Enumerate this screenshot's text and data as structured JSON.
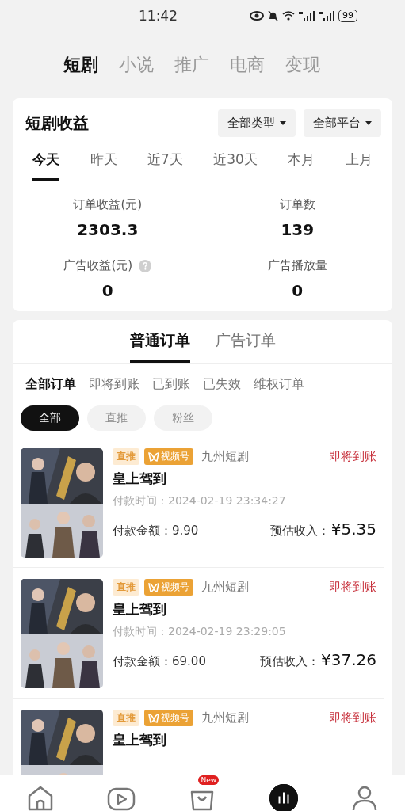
{
  "status_bar": {
    "time": "11:42",
    "battery": "99"
  },
  "top_tabs": [
    {
      "label": "短剧",
      "selected": true
    },
    {
      "label": "小说",
      "selected": false
    },
    {
      "label": "推广",
      "selected": false
    },
    {
      "label": "电商",
      "selected": false
    },
    {
      "label": "变现",
      "selected": false
    }
  ],
  "earnings": {
    "title": "短剧收益",
    "filters": [
      "全部类型",
      "全部平台"
    ],
    "periods": [
      {
        "label": "今天",
        "selected": true
      },
      {
        "label": "昨天",
        "selected": false
      },
      {
        "label": "近7天",
        "selected": false
      },
      {
        "label": "近30天",
        "selected": false
      },
      {
        "label": "本月",
        "selected": false
      },
      {
        "label": "上月",
        "selected": false
      }
    ],
    "stats": [
      {
        "label": "订单收益(元)",
        "value": "2303.3",
        "help": false
      },
      {
        "label": "订单数",
        "value": "139",
        "help": false
      },
      {
        "label": "广告收益(元)",
        "value": "0",
        "help": true
      },
      {
        "label": "广告播放量",
        "value": "0",
        "help": false
      }
    ]
  },
  "orders": {
    "tabs": [
      {
        "label": "普通订单",
        "selected": true
      },
      {
        "label": "广告订单",
        "selected": false
      }
    ],
    "status_tabs": [
      {
        "label": "全部订单",
        "selected": true
      },
      {
        "label": "即将到账",
        "selected": false
      },
      {
        "label": "已到账",
        "selected": false
      },
      {
        "label": "已失效",
        "selected": false
      },
      {
        "label": "维权订单",
        "selected": false
      }
    ],
    "chips": [
      {
        "label": "全部",
        "selected": true
      },
      {
        "label": "直推",
        "selected": false
      },
      {
        "label": "粉丝",
        "selected": false
      }
    ],
    "items": [
      {
        "tags": [
          {
            "kind": "direct",
            "label": "直推"
          },
          {
            "kind": "channel",
            "label": "视频号"
          }
        ],
        "platform": "九州短剧",
        "status": "即将到账",
        "title": "皇上驾到",
        "pay_time_label": "付款时间：",
        "pay_time": "2024-02-19 23:34:27",
        "amount_label": "付款金额：",
        "amount": "9.90",
        "income_label": "预估收入：",
        "income": "¥5.35"
      },
      {
        "tags": [
          {
            "kind": "direct",
            "label": "直推"
          },
          {
            "kind": "channel",
            "label": "视频号"
          }
        ],
        "platform": "九州短剧",
        "status": "即将到账",
        "title": "皇上驾到",
        "pay_time_label": "付款时间：",
        "pay_time": "2024-02-19 23:29:05",
        "amount_label": "付款金额：",
        "amount": "69.00",
        "income_label": "预估收入：",
        "income": "¥37.26"
      },
      {
        "tags": [
          {
            "kind": "direct",
            "label": "直推"
          },
          {
            "kind": "channel",
            "label": "视频号"
          }
        ],
        "platform": "九州短剧",
        "status": "即将到账",
        "title": "皇上驾到"
      }
    ]
  },
  "bottom_nav": [
    {
      "kind": "home",
      "selected": false
    },
    {
      "kind": "video",
      "selected": false
    },
    {
      "kind": "shop",
      "selected": false,
      "badge": "New"
    },
    {
      "kind": "stats",
      "selected": true
    },
    {
      "kind": "profile",
      "selected": false
    }
  ]
}
